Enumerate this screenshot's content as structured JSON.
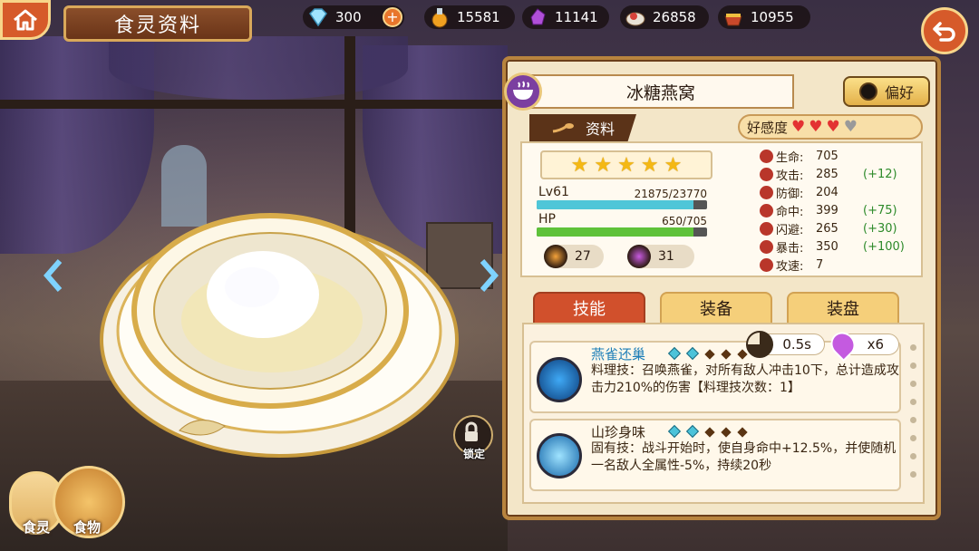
{
  "header": {
    "title": "食灵资料",
    "resources": [
      {
        "icon": "diamond-icon",
        "value": "300"
      },
      {
        "icon": "oil-flask-icon",
        "value": "15581"
      },
      {
        "icon": "purple-crystal-icon",
        "value": "11141"
      },
      {
        "icon": "meat-ingredient-icon",
        "value": "26858"
      },
      {
        "icon": "food-basket-icon",
        "value": "10955"
      }
    ]
  },
  "left": {
    "lock_label": "锁定",
    "avatar_foodsoul_label": "食灵",
    "avatar_food_label": "食物"
  },
  "panel": {
    "name": "冰糖燕窝",
    "preference_label": "偏好",
    "info_tab_label": "资料",
    "affinity_label": "好感度",
    "affinity_hearts": {
      "filled": 3,
      "total": 4
    },
    "stars": 5,
    "level_label": "Lv61",
    "exp_text": "21875/23770",
    "exp_fraction": 0.92,
    "hp_label": "HP",
    "hp_text": "650/705",
    "hp_fraction": 0.92,
    "item_count_1": "27",
    "item_count_2": "31",
    "stats": [
      {
        "icon": "heart-stat-icon",
        "name": "生命:",
        "value": "705",
        "bonus": ""
      },
      {
        "icon": "sword-stat-icon",
        "name": "攻击:",
        "value": "285",
        "bonus": "(+12)"
      },
      {
        "icon": "shield-stat-icon",
        "name": "防御:",
        "value": "204",
        "bonus": ""
      },
      {
        "icon": "crosshair-stat-icon",
        "name": "命中:",
        "value": "399",
        "bonus": "(+75)"
      },
      {
        "icon": "dodge-stat-icon",
        "name": "闪避:",
        "value": "265",
        "bonus": "(+30)"
      },
      {
        "icon": "crit-stat-icon",
        "name": "暴击:",
        "value": "350",
        "bonus": "(+100)"
      },
      {
        "icon": "speed-stat-icon",
        "name": "攻速:",
        "value": "7",
        "bonus": ""
      }
    ],
    "tabs": {
      "skill": "技能",
      "equipment": "装备",
      "plate": "装盘"
    },
    "skills": [
      {
        "name": "燕雀还巢",
        "gems": [
          1,
          1,
          0,
          0,
          0
        ],
        "cooldown": "0.5s",
        "cost": "x6",
        "desc": "料理技：召唤燕雀，对所有敌人冲击10下，总计造成攻击力210%的伤害【料理技次数：1】"
      },
      {
        "name": "山珍身味",
        "gems": [
          1,
          1,
          0,
          0,
          0
        ],
        "desc": "固有技：战斗开始时，使自身命中+12.5%，并使随机一名敌人全属性-5%，持续20秒"
      }
    ]
  },
  "colors": {
    "accent_red": "#d1502c",
    "gold": "#f5cf7a",
    "exp_bar": "#4fc6d8",
    "hp_bar": "#5fc23a",
    "bonus_green": "#2d8a2a"
  }
}
